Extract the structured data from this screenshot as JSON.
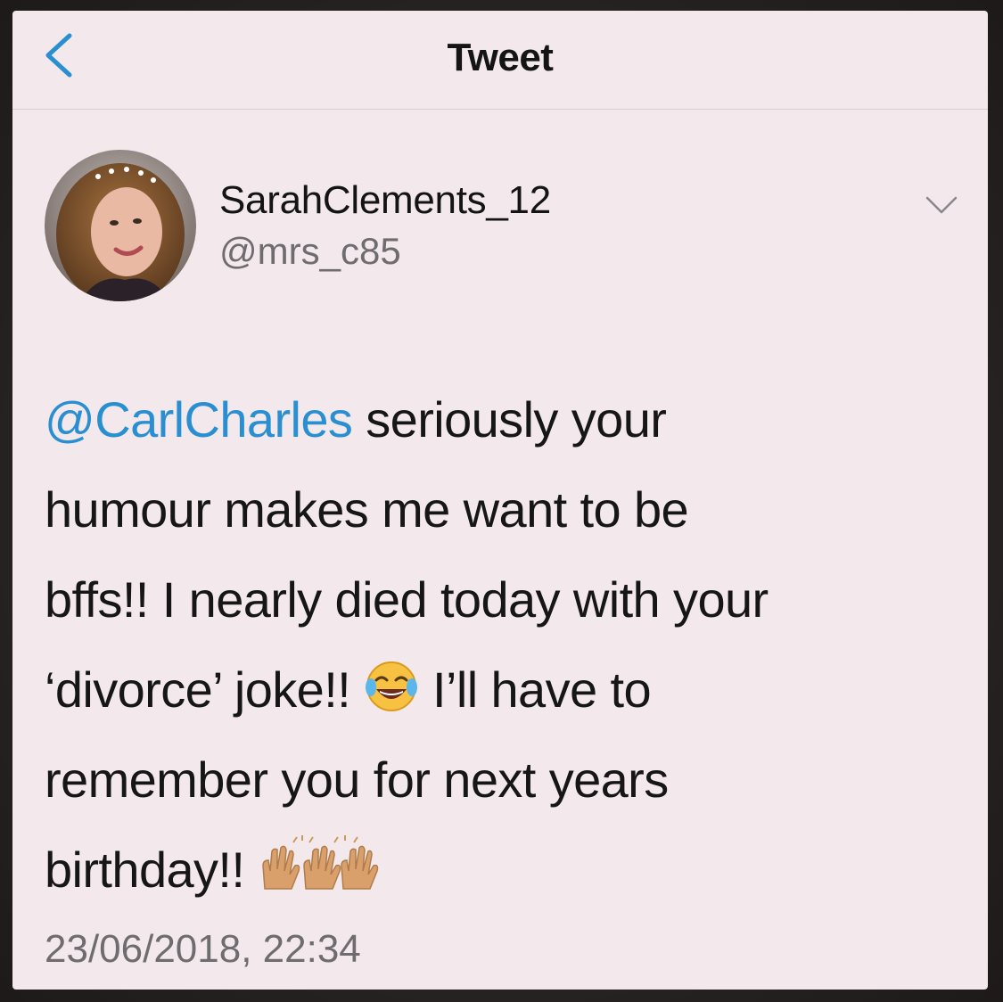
{
  "nav": {
    "title": "Tweet"
  },
  "author": {
    "display_name": "SarahClements_12",
    "handle": "@mrs_c85"
  },
  "tweet": {
    "mention": "@CarlCharles",
    "line1_rest": " seriously your",
    "line2": "humour makes me want to be",
    "line3": "bffs!! I nearly died today with your",
    "line4_before": "‘divorce’ joke!! ",
    "line4_after": " I’ll have to",
    "line5": "remember you for next years",
    "line6": "birthday!! ",
    "emojis": [
      "face-with-tears-of-joy-icon",
      "raising-hands-icon"
    ]
  },
  "timestamp": "23/06/2018, 22:34",
  "colors": {
    "background": "#f3e9ec",
    "accent": "#2a8fd0",
    "secondary_text": "#6f6c70"
  }
}
